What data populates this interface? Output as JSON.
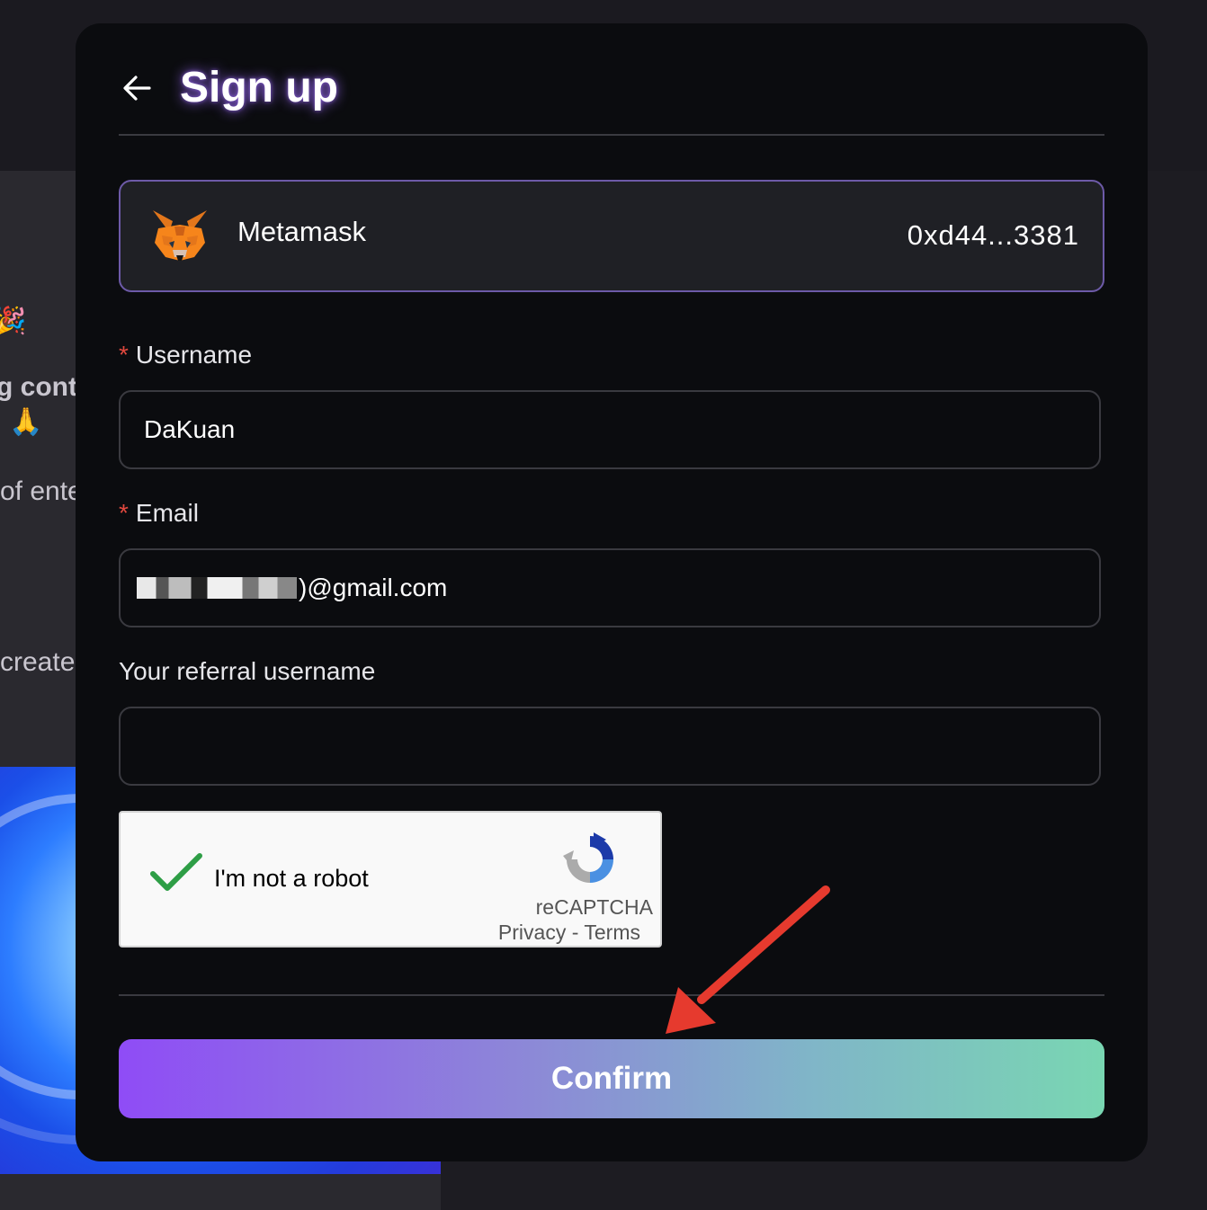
{
  "background": {
    "snippets": [
      "g cont",
      "of ente",
      "create"
    ],
    "emojis": [
      "🎉",
      "🙏"
    ]
  },
  "modal": {
    "title": "Sign up",
    "wallet": {
      "name": "Metamask",
      "address": "0xd44...3381",
      "icon": "metamask-fox-icon"
    },
    "fields": {
      "username": {
        "label": "Username",
        "required_mark": "*",
        "value": "DaKuan"
      },
      "email": {
        "label": "Email",
        "required_mark": "*",
        "value_visible": ")@gmail.com"
      },
      "referral": {
        "label": "Your referral username",
        "value": ""
      }
    },
    "captcha": {
      "label": "I'm not a robot",
      "brand": "reCAPTCHA",
      "privacy": "Privacy",
      "separator": "-",
      "terms": "Terms",
      "checked": true
    },
    "confirm_label": "Confirm"
  },
  "colors": {
    "required": "#e0483e",
    "wallet_border": "#6d5aa8",
    "button_gradient": [
      "#8f4cf6",
      "#79d6b2"
    ],
    "annotation_arrow": "#e63a2e"
  }
}
